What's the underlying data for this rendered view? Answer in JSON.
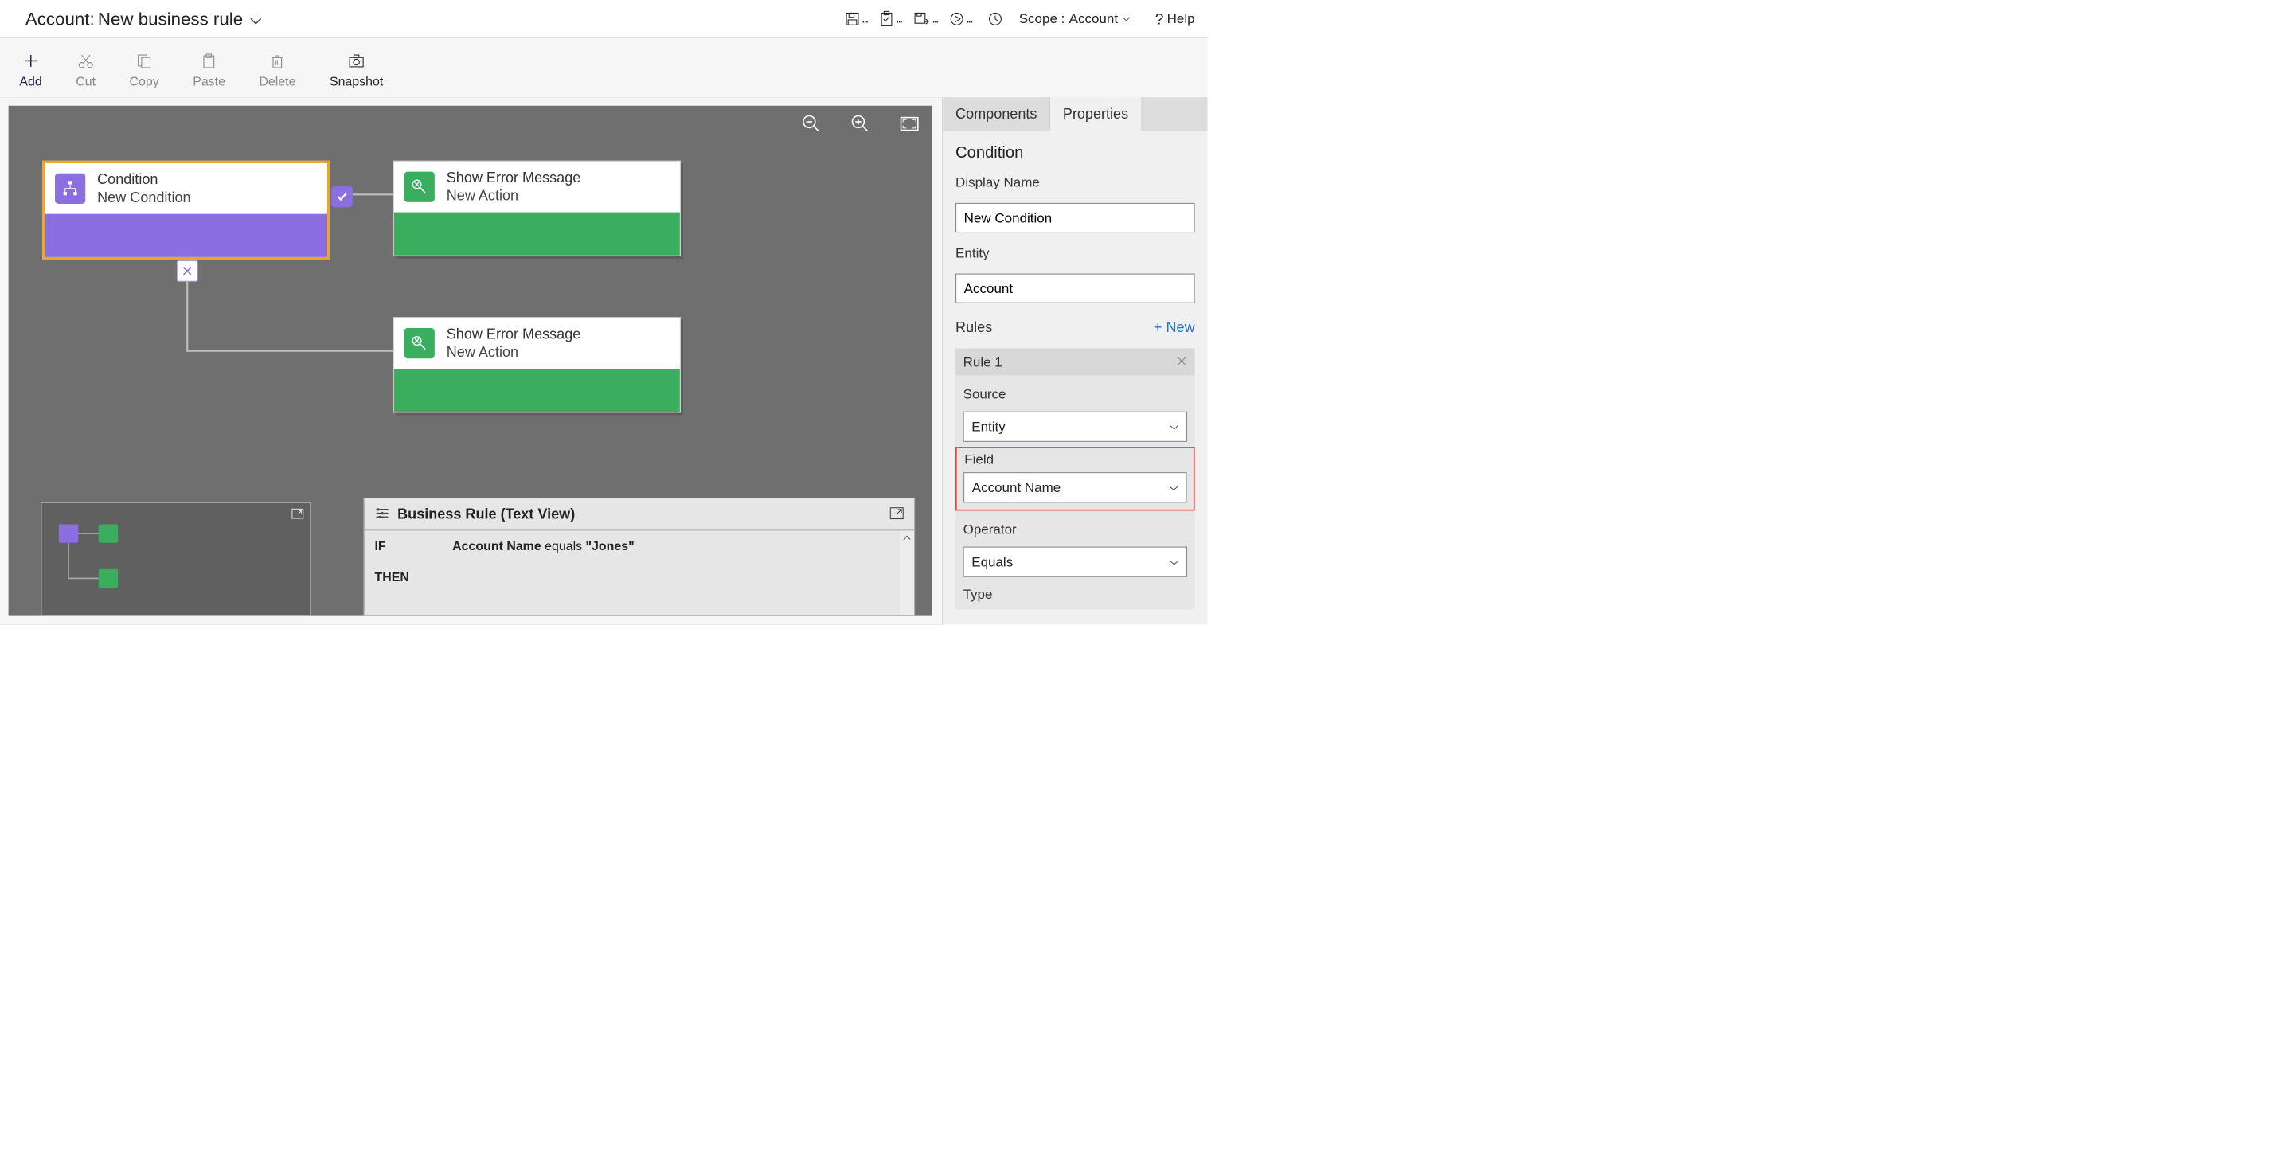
{
  "title": {
    "label": "Account:",
    "name": "New business rule"
  },
  "topbar": {
    "scope_label": "Scope :",
    "scope_value": "Account",
    "help": "Help"
  },
  "toolbar": {
    "add": "Add",
    "cut": "Cut",
    "copy": "Copy",
    "paste": "Paste",
    "delete": "Delete",
    "snapshot": "Snapshot"
  },
  "canvas": {
    "condition": {
      "title": "Condition",
      "sub": "New Condition"
    },
    "action1": {
      "title": "Show Error Message",
      "sub": "New Action"
    },
    "action2": {
      "title": "Show Error Message",
      "sub": "New Action"
    }
  },
  "textview": {
    "title": "Business Rule (Text View)",
    "if_label": "IF",
    "then_label": "THEN",
    "if_field": "Account Name",
    "if_mid": " equals ",
    "if_val": "\"Jones\""
  },
  "tabs": {
    "components": "Components",
    "properties": "Properties"
  },
  "props": {
    "heading": "Condition",
    "display_name_label": "Display Name",
    "display_name_value": "New Condition",
    "entity_label": "Entity",
    "entity_value": "Account",
    "rules_label": "Rules",
    "add_new": "+  New",
    "rule1_label": "Rule 1",
    "source_label": "Source",
    "source_value": "Entity",
    "field_label": "Field",
    "field_value": "Account Name",
    "operator_label": "Operator",
    "operator_value": "Equals",
    "type_label": "Type"
  }
}
